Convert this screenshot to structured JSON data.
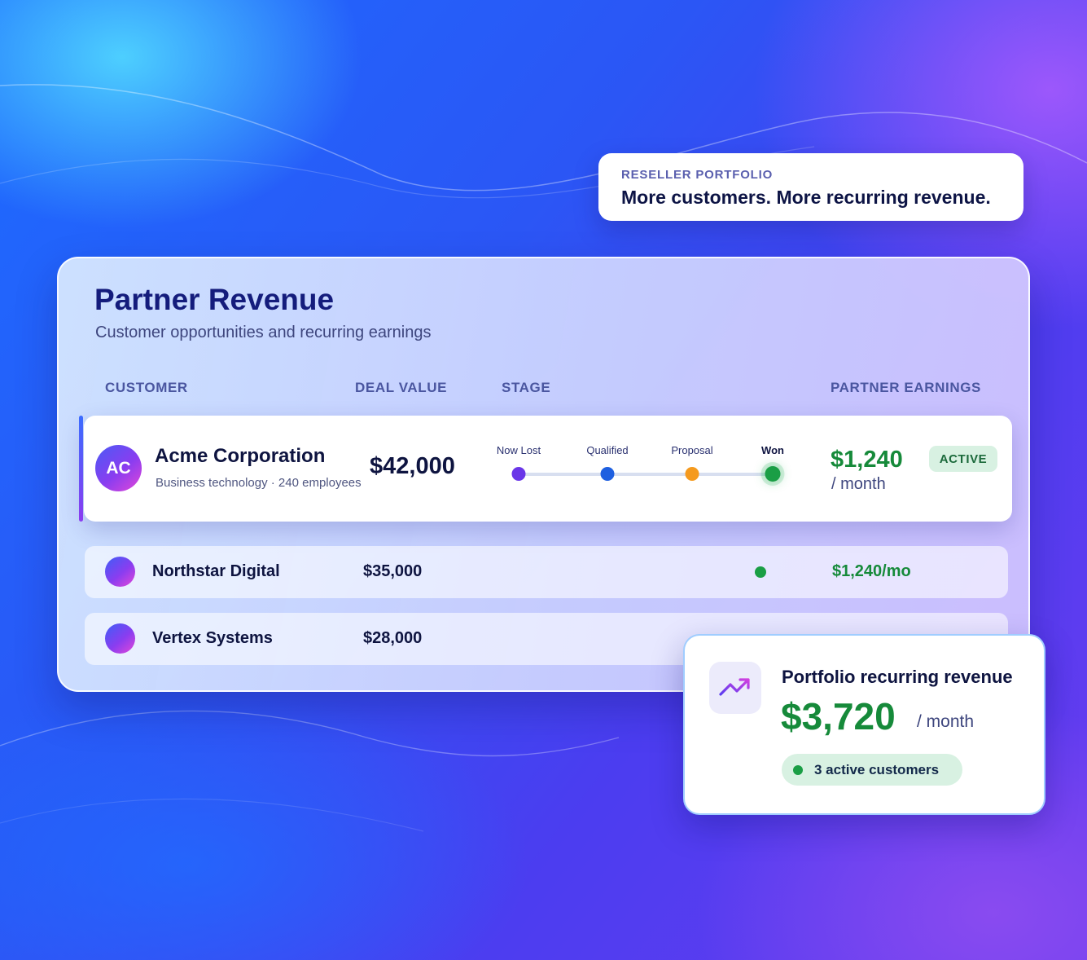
{
  "callout": {
    "eyebrow": "RESELLER PORTFOLIO",
    "headline": "More customers. More recurring revenue."
  },
  "panel": {
    "title": "Partner Revenue",
    "subtitle": "Customer opportunities and recurring earnings"
  },
  "columns": {
    "customer": "CUSTOMER",
    "deal_value": "DEAL VALUE",
    "stage": "STAGE",
    "partner_earnings": "PARTNER EARNINGS"
  },
  "featured": {
    "initials": "AC",
    "name": "Acme Corporation",
    "meta": "Business technology · 240 employees",
    "deal_value": "$42,000",
    "stages": [
      {
        "label": "Now Lost",
        "color": "#6a36e8"
      },
      {
        "label": "Qualified",
        "color": "#1e5fe0"
      },
      {
        "label": "Proposal",
        "color": "#f59a1e"
      },
      {
        "label": "Won",
        "color": "#1a9e45"
      }
    ],
    "earnings": "$1,240",
    "earnings_unit": "/ month",
    "status": "ACTIVE"
  },
  "rows": [
    {
      "name": "Northstar Digital",
      "deal_value": "$35,000",
      "earnings": "$1,240/mo",
      "stage_color": "#1a9e45"
    },
    {
      "name": "Vertex Systems",
      "deal_value": "$28,000"
    }
  ],
  "portfolio": {
    "icon": "trend-up-icon",
    "title": "Portfolio recurring revenue",
    "value": "$3,720",
    "unit": "/ month",
    "badge": "3 active customers"
  },
  "colors": {
    "brand_navy": "#141c7c",
    "earnings_green": "#168a3a",
    "active_dot_green": "#1a9e45"
  }
}
